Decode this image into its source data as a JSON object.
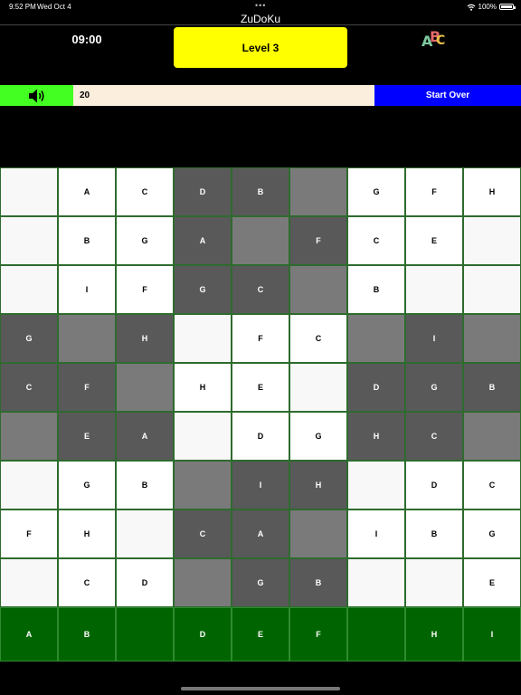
{
  "status_bar": {
    "time": "9:52 PM",
    "date": "Wed Oct 4",
    "dots": "•••",
    "battery": "100%"
  },
  "app": {
    "title": "ZuDoKu"
  },
  "header": {
    "timer": "09:00",
    "level_label": "Level 3"
  },
  "toolbar": {
    "moves_value": "20",
    "start_over_label": "Start Over"
  },
  "board": {
    "rows": [
      [
        "",
        "A",
        "C",
        "D",
        "B",
        "",
        "G",
        "F",
        "H"
      ],
      [
        "",
        "B",
        "G",
        "A",
        "",
        "F",
        "C",
        "E",
        ""
      ],
      [
        "",
        "I",
        "F",
        "G",
        "C",
        "",
        "B",
        "",
        ""
      ],
      [
        "G",
        "",
        "H",
        "",
        "F",
        "C",
        "",
        "I",
        ""
      ],
      [
        "C",
        "F",
        "",
        "H",
        "E",
        "",
        "D",
        "G",
        "B"
      ],
      [
        "",
        "E",
        "A",
        "",
        "D",
        "G",
        "H",
        "C",
        ""
      ],
      [
        "",
        "G",
        "B",
        "",
        "I",
        "H",
        "",
        "D",
        "C"
      ],
      [
        "F",
        "H",
        "",
        "C",
        "A",
        "",
        "I",
        "B",
        "G"
      ],
      [
        "",
        "C",
        "D",
        "",
        "G",
        "B",
        "",
        "",
        "E"
      ]
    ]
  },
  "palette": {
    "letters": [
      "A",
      "B",
      "",
      "D",
      "E",
      "F",
      "",
      "H",
      "I"
    ]
  },
  "colors": {
    "level_button": "#ffff00",
    "sound_button": "#44ff22",
    "start_over": "#0000ff",
    "palette": "#006400",
    "cell_light": "#ffffff",
    "cell_dark": "#595959",
    "cell_empty_dark": "#7a7a7a",
    "grid_line": "#2e6b2e"
  },
  "icons": {
    "sound": "speaker-volume-icon",
    "alphabet": "abc-icon",
    "wifi": "wifi-icon",
    "battery": "battery-icon"
  }
}
